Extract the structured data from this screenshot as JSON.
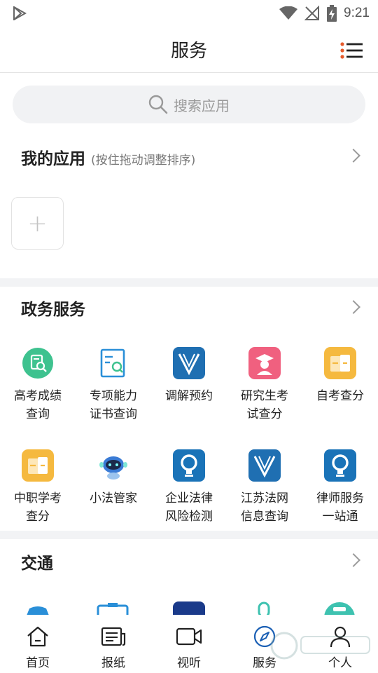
{
  "status_bar": {
    "time": "9:21"
  },
  "header": {
    "title": "服务"
  },
  "search": {
    "placeholder": "搜索应用"
  },
  "my_apps": {
    "title": "我的应用",
    "hint": "(按住拖动调整排序)"
  },
  "gov_services": {
    "title": "政务服务",
    "apps": [
      {
        "label": "高考成绩\n查询",
        "icon": "score-search-icon",
        "color": "#3ec28f"
      },
      {
        "label": "专项能力\n证书查询",
        "icon": "certificate-search-icon",
        "color": "#2a8fd8"
      },
      {
        "label": "调解预约",
        "icon": "v-logo-icon",
        "color": "#1f6fb2"
      },
      {
        "label": "研究生考\n试查分",
        "icon": "graduate-icon",
        "color": "#f0607f"
      },
      {
        "label": "自考查分",
        "icon": "folder-icon",
        "color": "#f5b93f"
      },
      {
        "label": "中职学考\n查分",
        "icon": "folder-icon",
        "color": "#f5b93f"
      },
      {
        "label": "小法管家",
        "icon": "robot-icon",
        "color": "#3a7bd5"
      },
      {
        "label": "企业法律\n风险检测",
        "icon": "bulb-icon",
        "color": "#1a73b8"
      },
      {
        "label": "江苏法网\n信息查询",
        "icon": "v-logo-icon",
        "color": "#1f6fb2"
      },
      {
        "label": "律师服务\n一站通",
        "icon": "bulb-icon",
        "color": "#1a73b8"
      }
    ]
  },
  "traffic": {
    "title": "交通"
  },
  "bottom_nav": [
    {
      "label": "首页",
      "icon": "home-icon"
    },
    {
      "label": "报纸",
      "icon": "newspaper-icon"
    },
    {
      "label": "视听",
      "icon": "video-icon"
    },
    {
      "label": "服务",
      "icon": "compass-icon"
    },
    {
      "label": "个人",
      "icon": "person-icon"
    }
  ]
}
